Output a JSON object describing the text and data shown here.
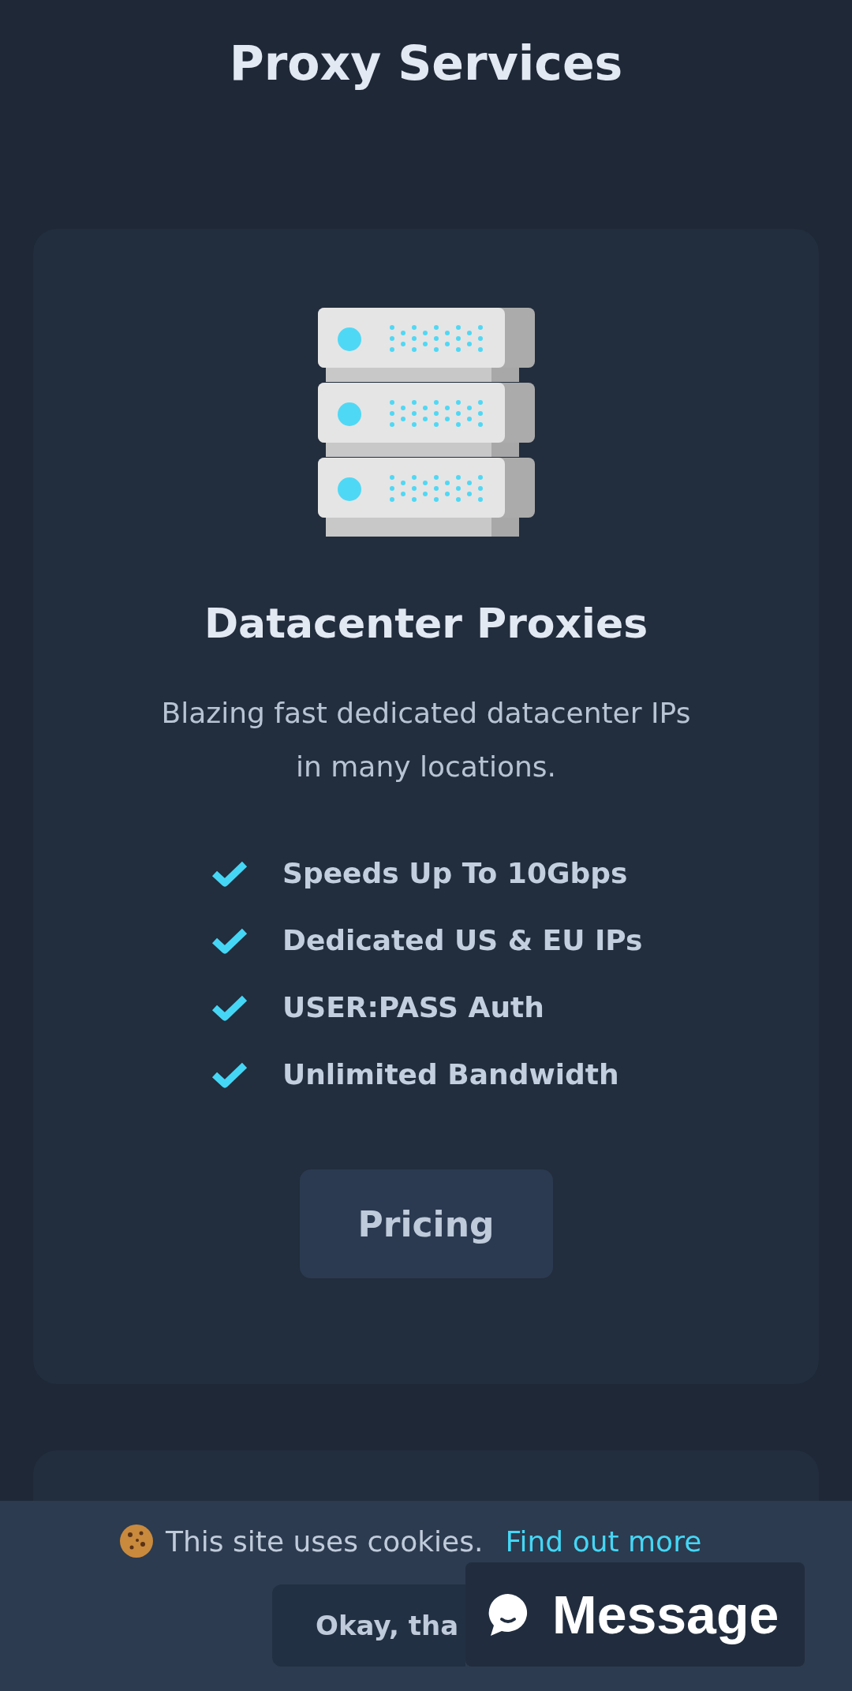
{
  "page_title": "Proxy Services",
  "card": {
    "title": "Datacenter Proxies",
    "description": "Blazing fast dedicated datacenter IPs in many locations.",
    "features": [
      "Speeds Up To 10Gbps",
      "Dedicated US & EU IPs",
      "USER:PASS Auth",
      "Unlimited Bandwidth"
    ],
    "button": "Pricing"
  },
  "cookie_bar": {
    "text": "This site uses cookies.",
    "link": "Find out more",
    "button": "Okay, tha"
  },
  "chat_widget": {
    "label": "Message"
  }
}
